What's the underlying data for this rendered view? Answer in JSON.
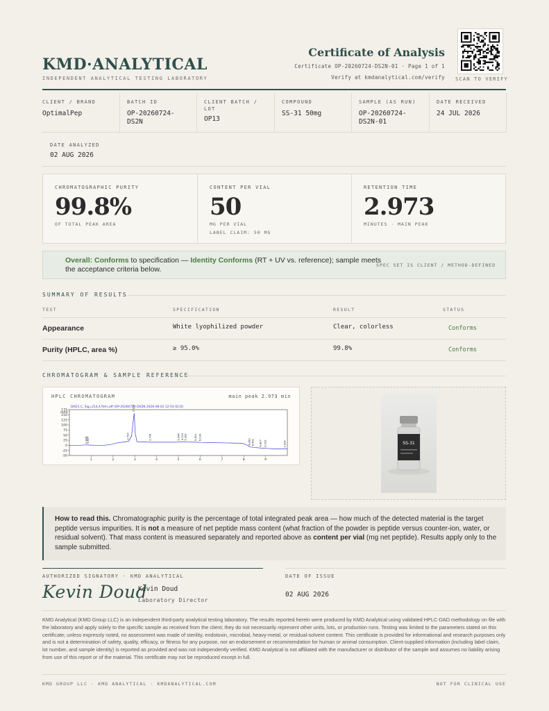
{
  "header": {
    "brand": "KMD·ANALYTICAL",
    "brand_sub": "INDEPENDENT ANALYTICAL TESTING LABORATORY",
    "title": "Certificate of Analysis",
    "cert_line": "Certificate OP-20260724-DS2N-01 · Page 1 of 1",
    "verify_line": "Verify at kmdanalytical.com/verify",
    "scan_label": "SCAN TO VERIFY",
    "qr_icon": "qr-code-icon"
  },
  "info": [
    {
      "label": "CLIENT / BRAND",
      "value": "OptimalPep"
    },
    {
      "label": "BATCH ID",
      "value": "OP-20260724-DS2N"
    },
    {
      "label": "CLIENT BATCH / LOT",
      "value": "OP13"
    },
    {
      "label": "COMPOUND",
      "value": "SS-31 50mg"
    },
    {
      "label": "SAMPLE (AS RUN)",
      "value": "OP-20260724-DS2N-01"
    },
    {
      "label": "DATE RECEIVED",
      "value": "24 JUL 2026"
    },
    {
      "label": "DATE ANALYZED",
      "value": "02 AUG 2026"
    }
  ],
  "metrics": [
    {
      "label": "CHROMATOGRAPHIC PURITY",
      "value": "99.8%",
      "sub": "OF TOTAL PEAK AREA",
      "sub2": ""
    },
    {
      "label": "CONTENT PER VIAL",
      "value": "50",
      "sub": "MG PER VIAL",
      "sub2": "LABEL CLAIM: 50 MG"
    },
    {
      "label": "RETENTION TIME",
      "value": "2.973",
      "sub": "MINUTES · MAIN PEAK",
      "sub2": ""
    }
  ],
  "overall": {
    "lead": "Overall: Conforms",
    "text1": " to specification — ",
    "identity": "Identity Conforms",
    "text2": " (RT + UV vs. reference); sample meets the acceptance criteria below.",
    "note": "SPEC SET IS CLIENT / METHOD-DEFINED"
  },
  "summary": {
    "title": "SUMMARY OF RESULTS",
    "headers": [
      "TEST",
      "SPECIFICATION",
      "RESULT",
      "STATUS"
    ],
    "rows": [
      {
        "test": "Appearance",
        "spec": "White lyophilized powder",
        "result": "Clear, colorless",
        "status": "Conforms"
      },
      {
        "test": "Purity (HPLC, area %)",
        "spec": "≥ 95.0%",
        "result": "99.8%",
        "status": "Conforms"
      }
    ]
  },
  "chromatogram": {
    "section_title": "CHROMATOGRAM & SAMPLE REFERENCE",
    "panel_title": "HPLC CHROMATOGRAM",
    "panel_note": "main peak 2.973 min",
    "trace_label": "DAD1 C, Sig=214,4 Ref=off (OP-20260724-DS2N 2026-08-02 12-53-02.D)",
    "unit": "mAU",
    "y_ticks": [
      "175",
      "150",
      "125",
      "100",
      "75",
      "50",
      "25",
      "0",
      "-25",
      "-50"
    ],
    "x_ticks": [
      "1",
      "2",
      "3",
      "4",
      "5",
      "6",
      "7",
      "8",
      "9"
    ],
    "peak_labels": [
      {
        "rt": 0.808,
        "text": "0.808"
      },
      {
        "rt": 0.897,
        "text": "0.897"
      },
      {
        "rt": 2.72,
        "text": "2.720"
      },
      {
        "rt": 2.973,
        "text": "2.973"
      },
      {
        "rt": 3.736,
        "text": "3.736"
      },
      {
        "rt": 5.044,
        "text": "5.044"
      },
      {
        "rt": 5.219,
        "text": "5.219"
      },
      {
        "rt": 5.362,
        "text": "5.362"
      },
      {
        "rt": 5.821,
        "text": "5.821"
      },
      {
        "rt": 6.034,
        "text": "6.034"
      },
      {
        "rt": 8.289,
        "text": "8.289"
      },
      {
        "rt": 8.451,
        "text": "8.451"
      },
      {
        "rt": 8.807,
        "text": "8.807"
      },
      {
        "rt": 9.029,
        "text": "9.029"
      },
      {
        "rt": 9.924,
        "text": "9.924"
      }
    ],
    "vial_label": "SS-31"
  },
  "chart_data": {
    "type": "line",
    "title": "",
    "xlabel": "",
    "ylabel": "mAU",
    "xlim": [
      0,
      10
    ],
    "ylim": [
      -50,
      175
    ],
    "series": [
      {
        "name": "DAD1 C, Sig=214,4 Ref=off (OP-20260724-DS2N 2026-08-02 12-53-02.D)",
        "x": [
          0,
          0.5,
          0.81,
          0.9,
          1.2,
          1.6,
          1.9,
          2.2,
          2.5,
          2.72,
          2.85,
          2.93,
          2.973,
          3.02,
          3.1,
          3.5,
          3.74,
          4.2,
          4.8,
          5.04,
          5.22,
          5.36,
          5.82,
          6.03,
          6.5,
          7.0,
          7.5,
          7.9,
          8.1,
          8.29,
          8.45,
          8.81,
          9.03,
          9.5,
          9.92,
          10
        ],
        "y": [
          0,
          0,
          2,
          1,
          0,
          0,
          4,
          12,
          16,
          20,
          45,
          120,
          158,
          60,
          18,
          16,
          15,
          15,
          15,
          16,
          18,
          16,
          15,
          14,
          13,
          12,
          11,
          10,
          4,
          -8,
          -10,
          -14,
          -15,
          -18,
          -18,
          -18
        ]
      }
    ],
    "grid": false,
    "legend": "none"
  },
  "read": {
    "lead": "How to read this.",
    "t1": " Chromatographic purity is the percentage of total integrated peak area — how much of the detected material is the target peptide versus impurities. It is ",
    "not": "not",
    "t2": " a measure of net peptide mass content (what fraction of the powder is peptide versus counter-ion, water, or residual solvent). That mass content is measured separately and reported above as ",
    "cpv": "content per vial",
    "t3": " (mg net peptide). Results apply only to the sample submitted."
  },
  "signature": {
    "label": "AUTHORIZED SIGNATORY · KMD ANALYTICAL",
    "script": "Kevin Doud",
    "name": "Kevin Doud",
    "role": "Laboratory Director",
    "date_label": "DATE OF ISSUE",
    "date": "02 AUG 2026"
  },
  "legal": "KMD Analytical (KMD Group LLC) is an independent third-party analytical testing laboratory. The results reported herein were produced by KMD Analytical using validated HPLC-DAD methodology on file with the laboratory and apply solely to the specific sample as received from the client; they do not necessarily represent other units, lots, or production runs. Testing was limited to the parameters stated on this certificate; unless expressly noted, no assessment was made of sterility, endotoxin, microbial, heavy-metal, or residual-solvent content. This certificate is provided for informational and research purposes only and is not a determination of safety, quality, efficacy, or fitness for any purpose, nor an endorsement or recommendation for human or animal consumption. Client-supplied information (including label claim, lot number, and sample identity) is reported as provided and was not independently verified. KMD Analytical is not affiliated with the manufacturer or distributor of the sample and assumes no liability arising from use of this report or of the material. This certificate may not be reproduced except in full.",
  "footer": {
    "left": "KMD GROUP LLC · KMD ANALYTICAL · KMDANALYTICAL.COM",
    "right": "NOT FOR CLINICAL USE"
  },
  "colors": {
    "accent": "#2f4f4c",
    "conforms": "#4a7a45",
    "paper": "#f3f0e9",
    "trace": "#3b3bd6"
  }
}
